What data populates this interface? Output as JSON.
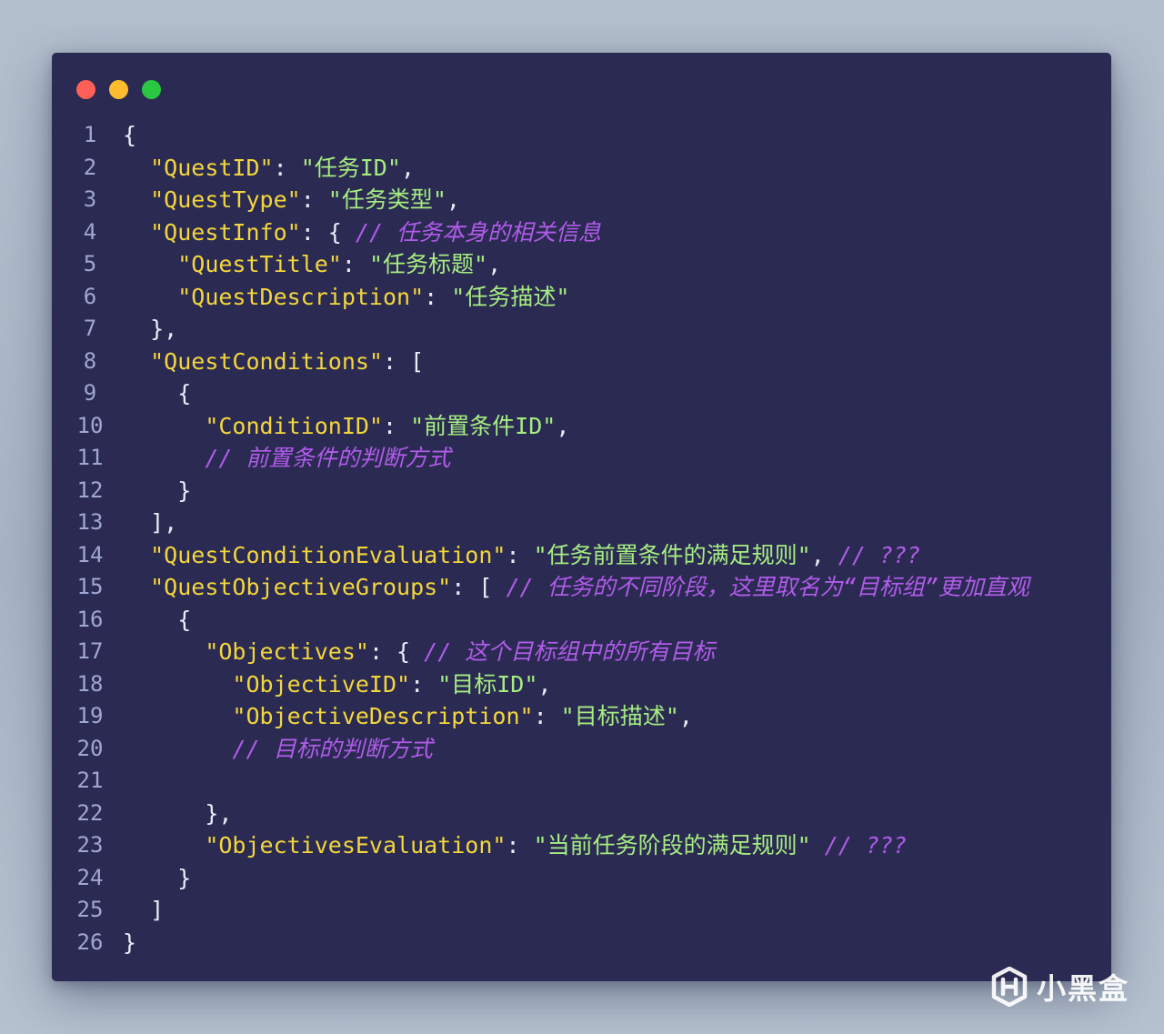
{
  "window": {
    "traffic_lights": [
      {
        "name": "close",
        "color": "#fe5f57"
      },
      {
        "name": "minimize",
        "color": "#febc2e"
      },
      {
        "name": "maximize",
        "color": "#29c840"
      }
    ],
    "background": "#2b2a53"
  },
  "colors": {
    "key": "#f3d63c",
    "string": "#a6ed80",
    "punctuation": "#e9ecf7",
    "comment": "#b05ce9",
    "line_number": "#9fa7d2"
  },
  "code": {
    "lines": [
      {
        "n": "1",
        "indent": 0,
        "tokens": [
          {
            "t": "p",
            "v": "{"
          }
        ]
      },
      {
        "n": "2",
        "indent": 1,
        "tokens": [
          {
            "t": "k",
            "v": "\"QuestID\""
          },
          {
            "t": "p",
            "v": ": "
          },
          {
            "t": "s",
            "v": "\"任务ID\""
          },
          {
            "t": "p",
            "v": ","
          }
        ]
      },
      {
        "n": "3",
        "indent": 1,
        "tokens": [
          {
            "t": "k",
            "v": "\"QuestType\""
          },
          {
            "t": "p",
            "v": ": "
          },
          {
            "t": "s",
            "v": "\"任务类型\""
          },
          {
            "t": "p",
            "v": ","
          }
        ]
      },
      {
        "n": "4",
        "indent": 1,
        "tokens": [
          {
            "t": "k",
            "v": "\"QuestInfo\""
          },
          {
            "t": "p",
            "v": ": { "
          },
          {
            "t": "c",
            "v": "// 任务本身的相关信息"
          }
        ]
      },
      {
        "n": "5",
        "indent": 2,
        "tokens": [
          {
            "t": "k",
            "v": "\"QuestTitle\""
          },
          {
            "t": "p",
            "v": ": "
          },
          {
            "t": "s",
            "v": "\"任务标题\""
          },
          {
            "t": "p",
            "v": ","
          }
        ]
      },
      {
        "n": "6",
        "indent": 2,
        "tokens": [
          {
            "t": "k",
            "v": "\"QuestDescription\""
          },
          {
            "t": "p",
            "v": ": "
          },
          {
            "t": "s",
            "v": "\"任务描述\""
          }
        ]
      },
      {
        "n": "7",
        "indent": 1,
        "tokens": [
          {
            "t": "p",
            "v": "},"
          }
        ]
      },
      {
        "n": "8",
        "indent": 1,
        "tokens": [
          {
            "t": "k",
            "v": "\"QuestConditions\""
          },
          {
            "t": "p",
            "v": ": ["
          }
        ]
      },
      {
        "n": "9",
        "indent": 2,
        "tokens": [
          {
            "t": "p",
            "v": "{"
          }
        ]
      },
      {
        "n": "10",
        "indent": 3,
        "tokens": [
          {
            "t": "k",
            "v": "\"ConditionID\""
          },
          {
            "t": "p",
            "v": ": "
          },
          {
            "t": "s",
            "v": "\"前置条件ID\""
          },
          {
            "t": "p",
            "v": ","
          }
        ]
      },
      {
        "n": "11",
        "indent": 3,
        "tokens": [
          {
            "t": "c",
            "v": "// 前置条件的判断方式"
          }
        ]
      },
      {
        "n": "12",
        "indent": 2,
        "tokens": [
          {
            "t": "p",
            "v": "}"
          }
        ]
      },
      {
        "n": "13",
        "indent": 1,
        "tokens": [
          {
            "t": "p",
            "v": "],"
          }
        ]
      },
      {
        "n": "14",
        "indent": 1,
        "tokens": [
          {
            "t": "k",
            "v": "\"QuestConditionEvaluation\""
          },
          {
            "t": "p",
            "v": ": "
          },
          {
            "t": "s",
            "v": "\"任务前置条件的满足规则\""
          },
          {
            "t": "p",
            "v": ", "
          },
          {
            "t": "c",
            "v": "// ???"
          }
        ]
      },
      {
        "n": "15",
        "indent": 1,
        "tokens": [
          {
            "t": "k",
            "v": "\"QuestObjectiveGroups\""
          },
          {
            "t": "p",
            "v": ": [ "
          },
          {
            "t": "c",
            "v": "// 任务的不同阶段，这里取名为“目标组”更加直观"
          }
        ]
      },
      {
        "n": "16",
        "indent": 2,
        "tokens": [
          {
            "t": "p",
            "v": "{"
          }
        ]
      },
      {
        "n": "17",
        "indent": 3,
        "tokens": [
          {
            "t": "k",
            "v": "\"Objectives\""
          },
          {
            "t": "p",
            "v": ": { "
          },
          {
            "t": "c",
            "v": "// 这个目标组中的所有目标"
          }
        ]
      },
      {
        "n": "18",
        "indent": 4,
        "tokens": [
          {
            "t": "k",
            "v": "\"ObjectiveID\""
          },
          {
            "t": "p",
            "v": ": "
          },
          {
            "t": "s",
            "v": "\"目标ID\""
          },
          {
            "t": "p",
            "v": ","
          }
        ]
      },
      {
        "n": "19",
        "indent": 4,
        "tokens": [
          {
            "t": "k",
            "v": "\"ObjectiveDescription\""
          },
          {
            "t": "p",
            "v": ": "
          },
          {
            "t": "s",
            "v": "\"目标描述\""
          },
          {
            "t": "p",
            "v": ","
          }
        ]
      },
      {
        "n": "20",
        "indent": 4,
        "tokens": [
          {
            "t": "c",
            "v": "// 目标的判断方式"
          }
        ]
      },
      {
        "n": "21",
        "indent": 0,
        "tokens": []
      },
      {
        "n": "22",
        "indent": 3,
        "tokens": [
          {
            "t": "p",
            "v": "},"
          }
        ]
      },
      {
        "n": "23",
        "indent": 3,
        "tokens": [
          {
            "t": "k",
            "v": "\"ObjectivesEvaluation\""
          },
          {
            "t": "p",
            "v": ": "
          },
          {
            "t": "s",
            "v": "\"当前任务阶段的满足规则\""
          },
          {
            "t": "p",
            "v": " "
          },
          {
            "t": "c",
            "v": "// ???"
          }
        ]
      },
      {
        "n": "24",
        "indent": 2,
        "tokens": [
          {
            "t": "p",
            "v": "}"
          }
        ]
      },
      {
        "n": "25",
        "indent": 1,
        "tokens": [
          {
            "t": "p",
            "v": "]"
          }
        ]
      },
      {
        "n": "26",
        "indent": 0,
        "tokens": [
          {
            "t": "p",
            "v": "}"
          }
        ]
      }
    ]
  },
  "watermark": {
    "icon": "xiaoheihe-logo-icon",
    "text": "小黑盒"
  }
}
